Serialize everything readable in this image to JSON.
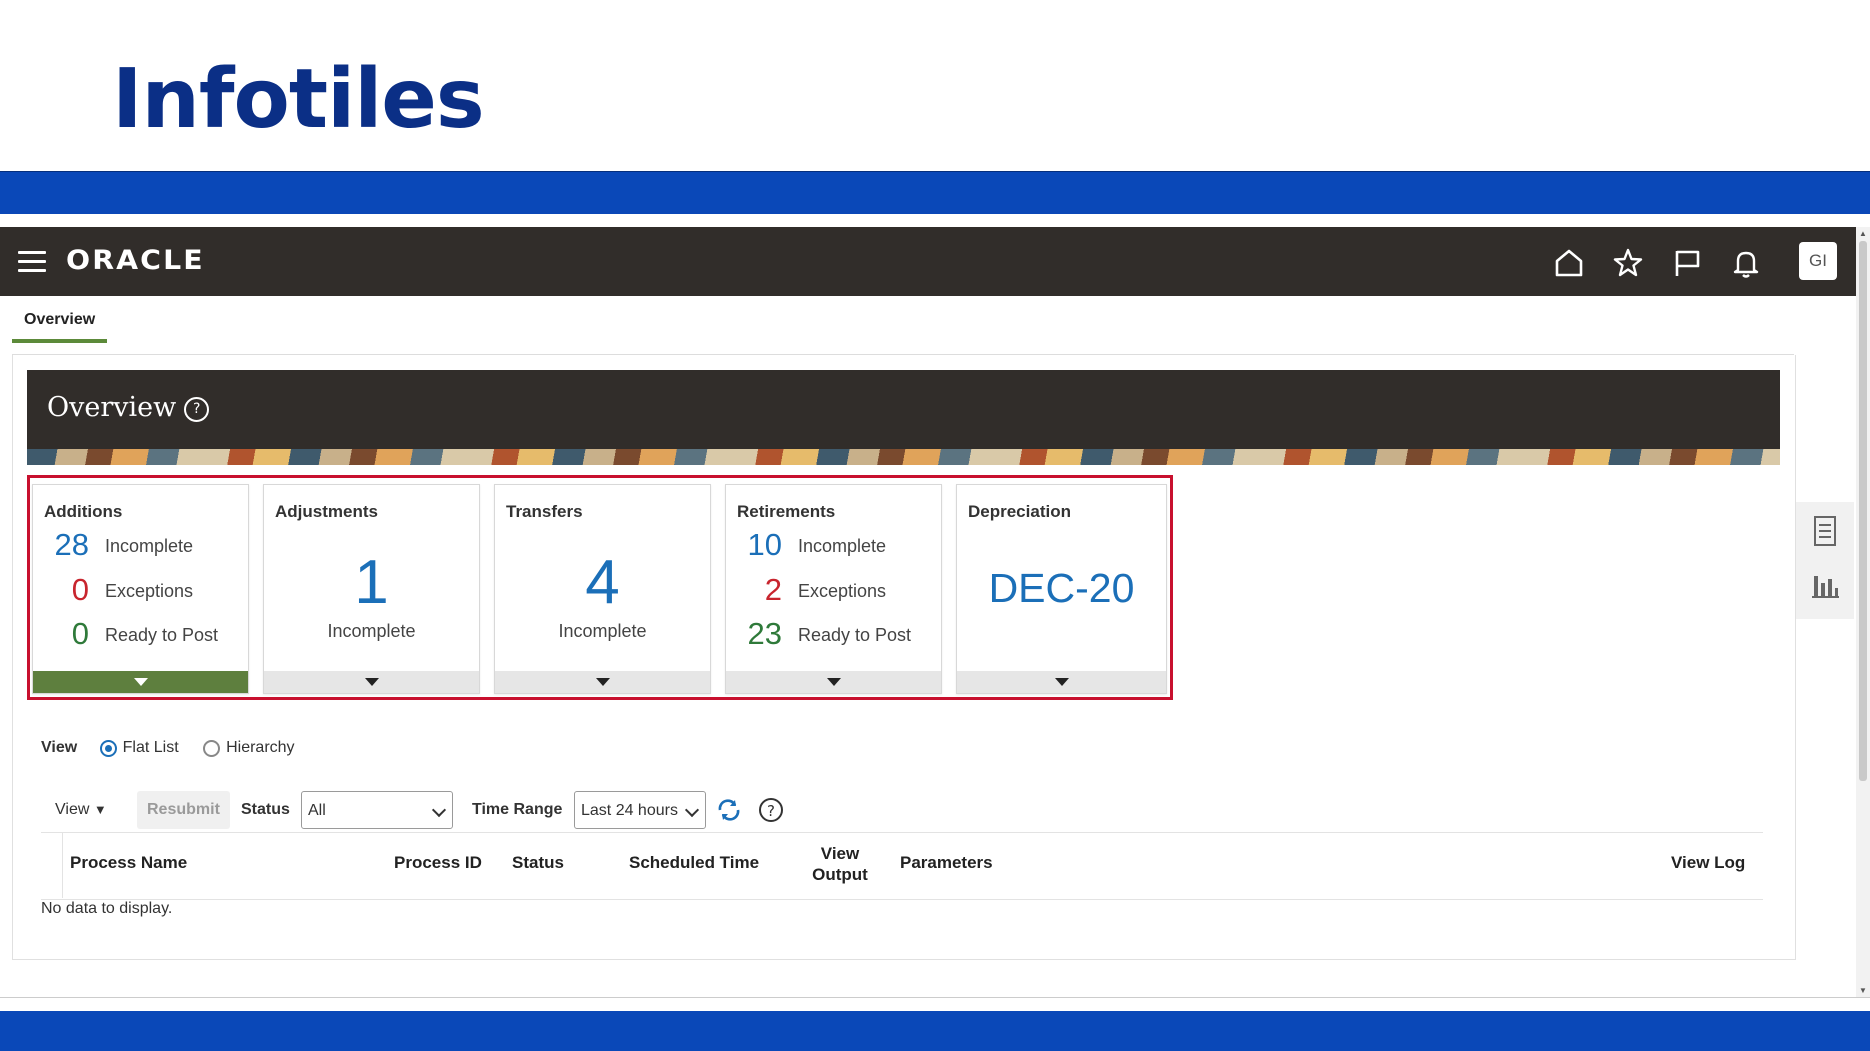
{
  "slide": {
    "title": "Infotiles"
  },
  "app": {
    "logo": "ORACLE",
    "avatar": "GI"
  },
  "nav_icons": [
    "home-icon",
    "star-icon",
    "flag-icon",
    "bell-icon"
  ],
  "tabs": [
    {
      "label": "Overview",
      "active": true
    }
  ],
  "banner": {
    "title": "Overview"
  },
  "tiles": {
    "additions": {
      "title": "Additions",
      "rows": [
        {
          "value": "28",
          "label": "Incomplete"
        },
        {
          "value": "0",
          "label": "Exceptions"
        },
        {
          "value": "0",
          "label": "Ready to Post"
        }
      ]
    },
    "adjustments": {
      "title": "Adjustments",
      "value": "1",
      "label": "Incomplete"
    },
    "transfers": {
      "title": "Transfers",
      "value": "4",
      "label": "Incomplete"
    },
    "retirements": {
      "title": "Retirements",
      "rows": [
        {
          "value": "10",
          "label": "Incomplete"
        },
        {
          "value": "2",
          "label": "Exceptions"
        },
        {
          "value": "23",
          "label": "Ready to Post"
        }
      ]
    },
    "depreciation": {
      "title": "Depreciation",
      "period": "DEC-20"
    }
  },
  "view_options": {
    "label": "View",
    "options": [
      "Flat List",
      "Hierarchy"
    ],
    "selected": "Flat List"
  },
  "toolbar": {
    "view_menu": "View",
    "resubmit": "Resubmit",
    "status_label": "Status",
    "status_value": "All",
    "time_range_label": "Time Range",
    "time_range_value": "Last 24 hours"
  },
  "table": {
    "columns": [
      "Process Name",
      "Process ID",
      "Status",
      "Scheduled Time",
      "View",
      "Output",
      "Parameters",
      "View Log"
    ],
    "empty_text": "No data to display."
  },
  "colors": {
    "topbar": "#312d2a",
    "band": "#0a48b8",
    "highlight": "#c8102e",
    "active_tile": "#5e7f3e",
    "metric_blue": "#1b6fb8"
  }
}
